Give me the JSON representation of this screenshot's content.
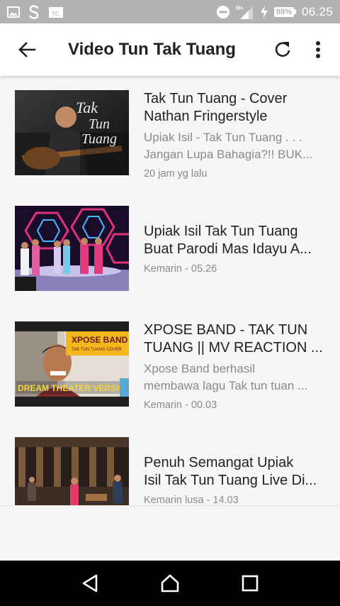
{
  "status_bar": {
    "time": "06.25",
    "battery": "98%",
    "signal_label": "H+"
  },
  "app_bar": {
    "title": "Video Tun Tak Tuang"
  },
  "videos": [
    {
      "title": "Tak Tun Tuang - Cover Nathan Fringerstyle",
      "title_line1": "Tak Tun Tuang - Cover",
      "title_line2": "Nathan Fringerstyle",
      "desc_line1": "Upiak Isil - Tak Tun Tuang . . .",
      "desc_line2": "Jangan Lupa Bahagia?!! BUK...",
      "time": "20 jam yg lalu",
      "thumb_text_1": "Tak",
      "thumb_text_2": "Tun",
      "thumb_text_3": "Tuang"
    },
    {
      "title_line1": "Upiak Isil Tak Tun Tuang",
      "title_line2": "Buat Parodi Mas Idayu A...",
      "time": "Kemarin - 05.26"
    },
    {
      "title_line1": "XPOSE BAND - TAK TUN",
      "title_line2": "TUANG || MV REACTION ...",
      "desc_line1": "Xpose Band berhasil",
      "desc_line2": "membawa lagu Tak tun tuan ...",
      "time": "Kemarin - 00.03",
      "thumb_text_1": "XPOSE BAND",
      "thumb_text_2": "TAK TUN TUANG COVER",
      "thumb_text_3": "DREAM THEATER VERSION"
    },
    {
      "title_line1": "Penuh Semangat Upiak",
      "title_line2": "Isil Tak Tun Tuang Live Di...",
      "time": "Kemarin lusa - 14.03"
    }
  ],
  "colors": {
    "status_bar": "#b3b3b3",
    "app_bar": "#ffffff",
    "background": "#f6f6f6",
    "title_text": "#222222",
    "secondary_text": "#8a8a8a",
    "nav_bar": "#000000"
  },
  "icons": [
    "image-icon",
    "s-icon",
    "tv-icon",
    "dnd-icon",
    "signal-icon",
    "flash-icon",
    "back-arrow-icon",
    "refresh-icon",
    "overflow-menu-icon",
    "nav-back-icon",
    "nav-home-icon",
    "nav-recents-icon"
  ]
}
